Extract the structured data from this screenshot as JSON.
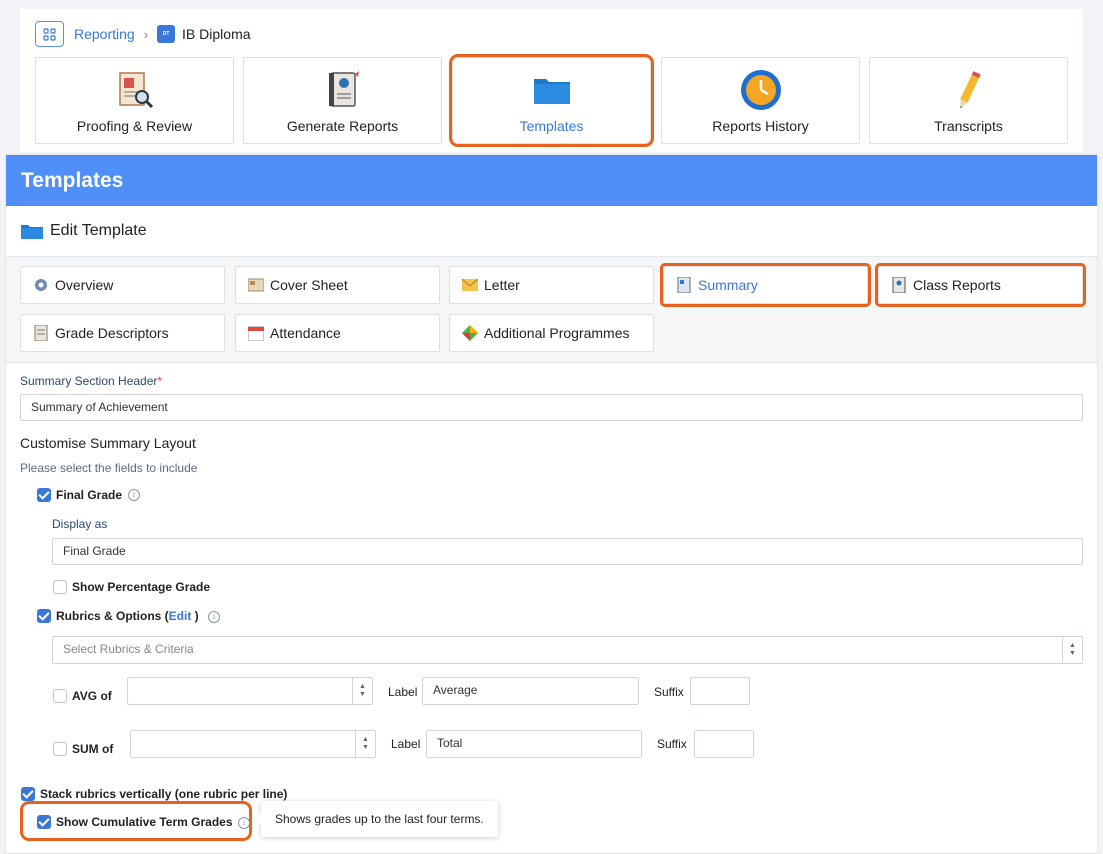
{
  "breadcrumb": {
    "parent": "Reporting",
    "badge": "DT",
    "current": "IB Diploma"
  },
  "nav_tiles": [
    {
      "label": "Proofing & Review",
      "icon": "proofing-icon"
    },
    {
      "label": "Generate Reports",
      "icon": "report-cards-icon"
    },
    {
      "label": "Templates",
      "icon": "folder-icon",
      "active": true
    },
    {
      "label": "Reports History",
      "icon": "clock-icon"
    },
    {
      "label": "Transcripts",
      "icon": "pencil-icon"
    }
  ],
  "panel": {
    "title": "Templates",
    "subtitle": "Edit Template"
  },
  "tabs": [
    {
      "label": "Overview",
      "icon": "gear-icon"
    },
    {
      "label": "Cover Sheet",
      "icon": "cover-sheet-icon"
    },
    {
      "label": "Letter",
      "icon": "envelope-icon"
    },
    {
      "label": "Summary",
      "icon": "summary-icon",
      "active": true
    },
    {
      "label": "Class Reports",
      "icon": "class-reports-icon"
    },
    {
      "label": "Grade Descriptors",
      "icon": "grade-descriptors-icon"
    },
    {
      "label": "Attendance",
      "icon": "calendar-icon"
    },
    {
      "label": "Additional Programmes",
      "icon": "programmes-icon"
    }
  ],
  "form": {
    "section_header_label": "Summary Section Header",
    "required_mark": "*",
    "section_header_value": "Summary of Achievement",
    "layout_title": "Customise Summary Layout",
    "layout_hint": "Please select the fields to include",
    "final_grade": {
      "label": "Final Grade",
      "checked": true
    },
    "display_as_label": "Display as",
    "display_as_value": "Final Grade",
    "show_percentage": {
      "label": "Show Percentage Grade",
      "checked": false
    },
    "rubrics": {
      "label": "Rubrics & Options (",
      "edit": "Edit",
      "close": " )",
      "checked": true
    },
    "rubrics_placeholder": "Select Rubrics & Criteria",
    "avg": {
      "label": "AVG of",
      "checked": false,
      "label_text": "Label",
      "label_value": "Average",
      "suffix_text": "Suffix"
    },
    "sum": {
      "label": "SUM of",
      "checked": false,
      "label_text": "Label",
      "label_value": "Total",
      "suffix_text": "Suffix"
    },
    "stack_rubrics": {
      "label": "Stack rubrics vertically (one rubric per line)",
      "checked": true
    },
    "cumulative": {
      "label": "Show Cumulative Term Grades",
      "checked": true
    },
    "tooltip": "Shows grades up to the last four terms.",
    "info_glyph": "i"
  },
  "colors": {
    "accent": "#3a78d6",
    "header": "#4f8ff7",
    "highlight": "#e8621e"
  }
}
